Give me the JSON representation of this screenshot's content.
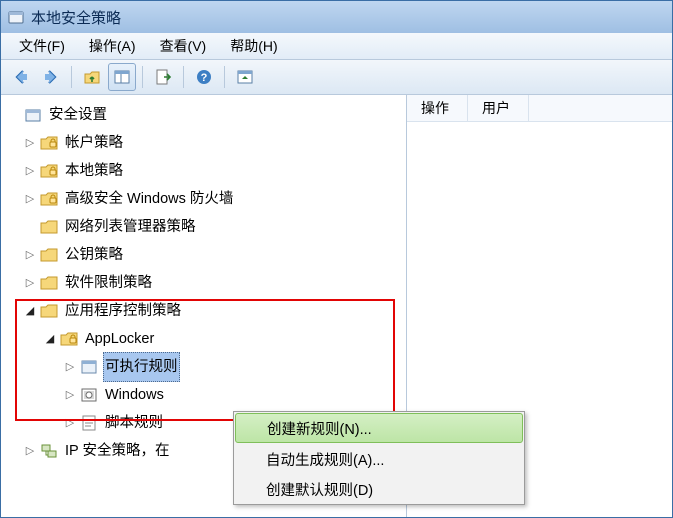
{
  "window": {
    "title": "本地安全策略"
  },
  "menu": {
    "file": "文件(F)",
    "action": "操作(A)",
    "view": "查看(V)",
    "help": "帮助(H)"
  },
  "tree": {
    "root": "安全设置",
    "items": [
      "帐户策略",
      "本地策略",
      "高级安全 Windows 防火墙",
      "网络列表管理器策略",
      "公钥策略",
      "软件限制策略",
      "应用程序控制策略"
    ],
    "applocker": "AppLocker",
    "exe_rules": "可执行规则",
    "win_rules": "Windows",
    "script_rules": "脚本规则",
    "ipsec": "IP 安全策略，在"
  },
  "right": {
    "col1": "操作",
    "col2": "用户"
  },
  "ctx": {
    "create": "创建新规则(N)...",
    "auto": "自动生成规则(A)...",
    "default": "创建默认规则(D)"
  }
}
